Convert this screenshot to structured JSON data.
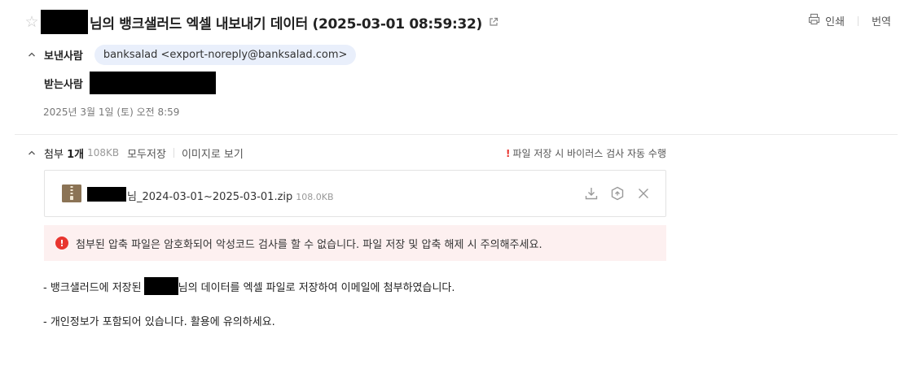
{
  "subject": {
    "title_suffix": "님의 뱅크샐러드 엑셀 내보내기 데이터 (2025-03-01 08:59:32)"
  },
  "actions": {
    "print_label": "인쇄",
    "translate_label": "번역"
  },
  "sender": {
    "label": "보낸사람",
    "chip": "banksalad <export-noreply@banksalad.com>"
  },
  "recipient": {
    "label": "받는사람"
  },
  "date": "2025년 3월 1일 (토) 오전 8:59",
  "attachments": {
    "label": "첨부",
    "count": "1개",
    "total_size": "108KB",
    "save_all_label": "모두저장",
    "view_as_image_label": "이미지로 보기",
    "virus_note_mark": "!",
    "virus_note": "파일 저장 시 바이러스 검사 자동 수행",
    "files": [
      {
        "name_suffix": "님_2024-03-01~2025-03-01.zip",
        "size": "108.0KB"
      }
    ]
  },
  "warning": {
    "icon": "!",
    "text": "첨부된 압축 파일은 암호화되어 악성코드 검사를 할 수 없습니다. 파일 저장 및 압축 해제 시 주의해주세요."
  },
  "body": {
    "line1_prefix": "- 뱅크샐러드에 저장된",
    "line1_suffix": "님의 데이터를 엑셀 파일로 저장하여 이메일에 첨부하였습니다.",
    "line2": "- 개인정보가 포함되어 있습니다. 활용에 유의하세요."
  },
  "colors": {
    "sender_chip_bg": "#e9effb",
    "warning_bg": "#fdf0f0",
    "alert_red": "#e8352f",
    "zip_brown": "#8b7355"
  }
}
